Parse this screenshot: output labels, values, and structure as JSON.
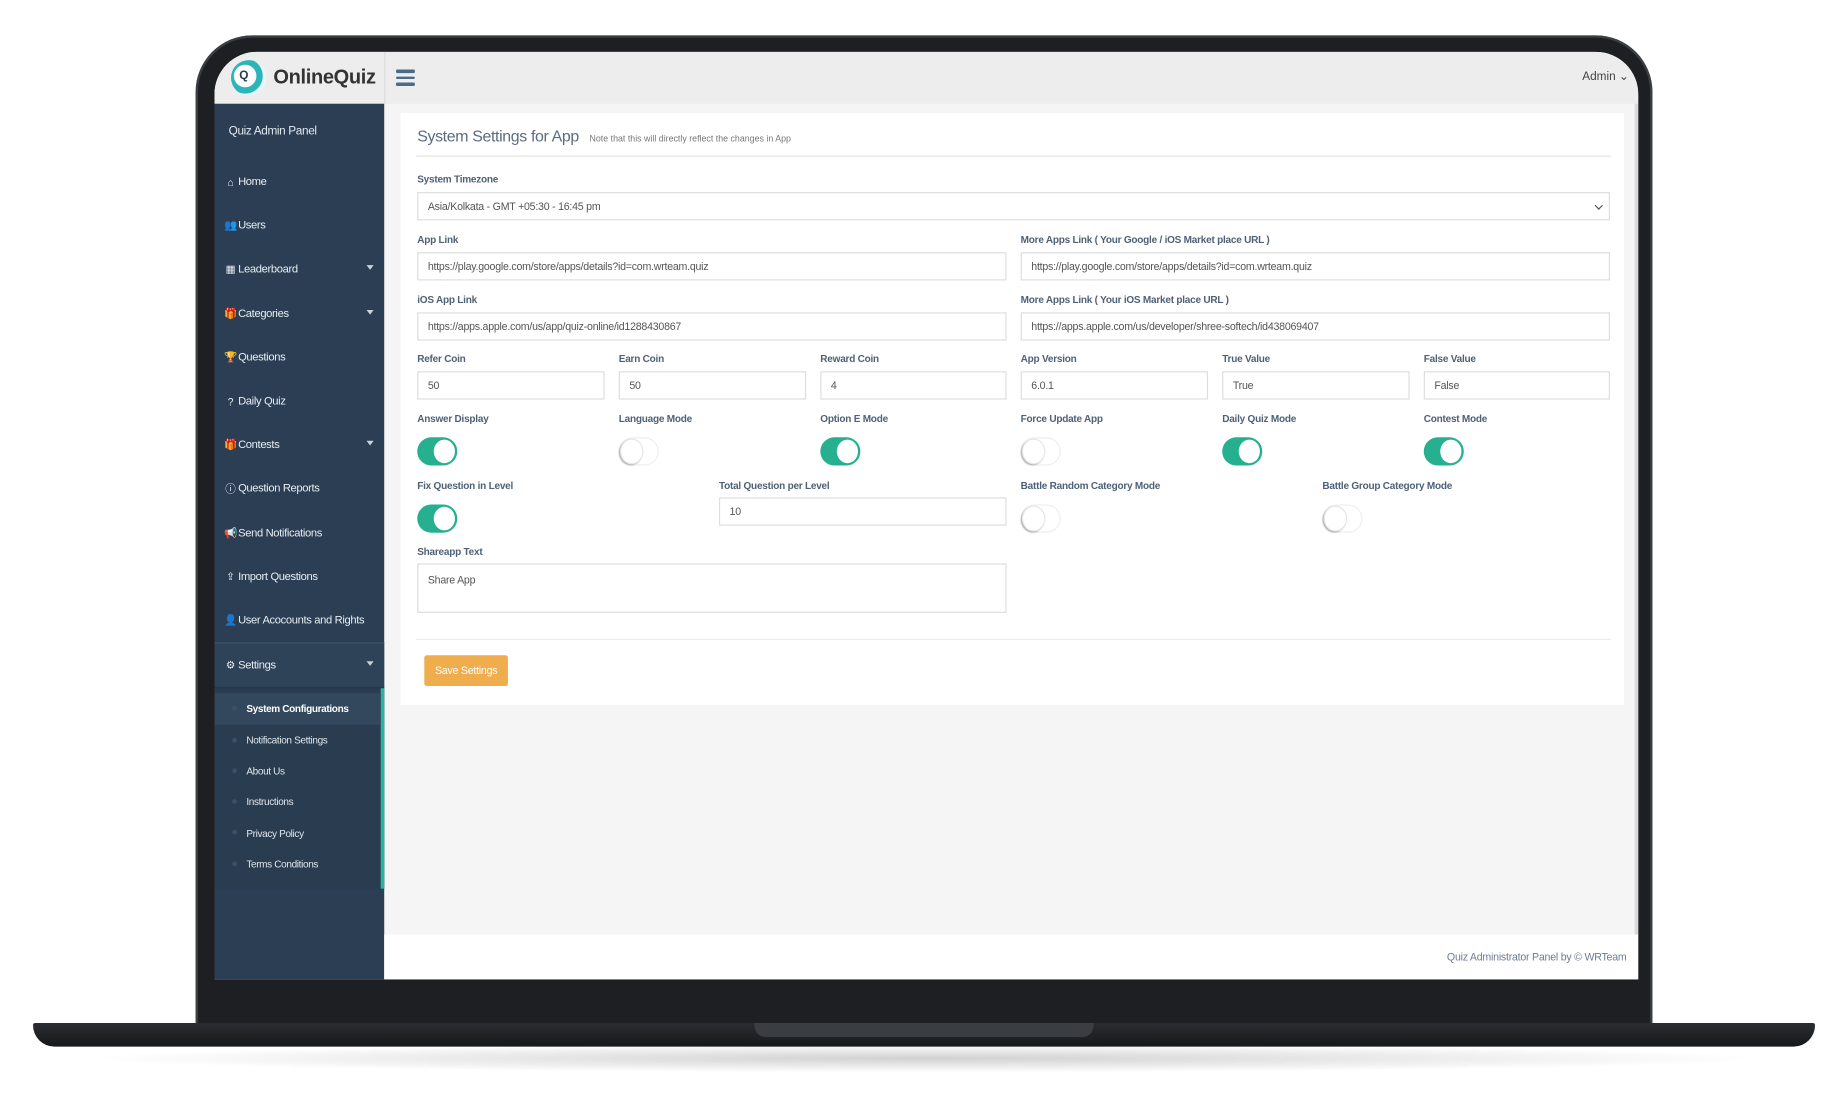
{
  "app": {
    "brand": "OnlineQuiz",
    "logo_text": "Q",
    "user_menu": "Admin"
  },
  "sidebar": {
    "panel_title": "Quiz Admin Panel",
    "items": [
      {
        "label": "Home",
        "icon": "home-icon",
        "glyph": "⌂",
        "has_caret": false
      },
      {
        "label": "Users",
        "icon": "users-icon",
        "glyph": "👥",
        "has_caret": false
      },
      {
        "label": "Leaderboard",
        "icon": "table-icon",
        "glyph": "▦",
        "has_caret": true
      },
      {
        "label": "Categories",
        "icon": "gift-icon",
        "glyph": "🎁",
        "has_caret": true
      },
      {
        "label": "Questions",
        "icon": "trophy-icon",
        "glyph": "🏆",
        "has_caret": false
      },
      {
        "label": "Daily Quiz",
        "icon": "question-icon",
        "glyph": "?",
        "has_caret": false
      },
      {
        "label": "Contests",
        "icon": "gift-icon",
        "glyph": "🎁",
        "has_caret": true
      },
      {
        "label": "Question Reports",
        "icon": "question-circle-icon",
        "glyph": "ⓘ",
        "has_caret": false
      },
      {
        "label": "Send Notifications",
        "icon": "bullhorn-icon",
        "glyph": "📢",
        "has_caret": false
      },
      {
        "label": "Import Questions",
        "icon": "upload-icon",
        "glyph": "⇪",
        "has_caret": false
      },
      {
        "label": "User Acocounts and Rights",
        "icon": "user-icon",
        "glyph": "👤",
        "has_caret": false
      },
      {
        "label": "Settings",
        "icon": "gear-icon",
        "glyph": "⚙",
        "has_caret": true
      }
    ],
    "settings_submenu": [
      {
        "label": "System Configurations",
        "active": true
      },
      {
        "label": "Notification Settings",
        "active": false
      },
      {
        "label": "About Us",
        "active": false
      },
      {
        "label": "Instructions",
        "active": false
      },
      {
        "label": "Privacy Policy",
        "active": false
      },
      {
        "label": "Terms Conditions",
        "active": false
      }
    ]
  },
  "form": {
    "title": "System Settings for App",
    "note": "Note that this will directly reflect the changes in App",
    "timezone": {
      "label": "System Timezone",
      "value": "Asia/Kolkata - GMT +05:30 - 16:45 pm"
    },
    "app_link": {
      "label": "App Link",
      "value": "https://play.google.com/store/apps/details?id=com.wrteam.quiz"
    },
    "more_apps_link": {
      "label": "More Apps Link ( Your Google / iOS Market place URL )",
      "value": "https://play.google.com/store/apps/details?id=com.wrteam.quiz"
    },
    "ios_app_link": {
      "label": "iOS App Link",
      "value": "https://apps.apple.com/us/app/quiz-online/id1288430867"
    },
    "more_apps_ios": {
      "label": "More Apps Link ( Your iOS Market place URL )",
      "value": "https://apps.apple.com/us/developer/shree-softech/id438069407"
    },
    "refer_coin": {
      "label": "Refer Coin",
      "value": "50"
    },
    "earn_coin": {
      "label": "Earn Coin",
      "value": "50"
    },
    "reward_coin": {
      "label": "Reward Coin",
      "value": "4"
    },
    "app_version": {
      "label": "App Version",
      "value": "6.0.1"
    },
    "true_value": {
      "label": "True Value",
      "value": "True"
    },
    "false_value": {
      "label": "False Value",
      "value": "False"
    },
    "toggles": {
      "answer_display": {
        "label": "Answer Display",
        "on": true
      },
      "language_mode": {
        "label": "Language Mode",
        "on": false
      },
      "option_e_mode": {
        "label": "Option E Mode",
        "on": true
      },
      "force_update_app": {
        "label": "Force Update App",
        "on": false
      },
      "daily_quiz_mode": {
        "label": "Daily Quiz Mode",
        "on": true
      },
      "contest_mode": {
        "label": "Contest Mode",
        "on": true
      },
      "fix_question_in_level": {
        "label": "Fix Question in Level",
        "on": true
      },
      "battle_random_category_mode": {
        "label": "Battle Random Category Mode",
        "on": false
      },
      "battle_group_category_mode": {
        "label": "Battle Group Category Mode",
        "on": false
      }
    },
    "total_question_per_level": {
      "label": "Total Question per Level",
      "value": "10"
    },
    "shareapp_text": {
      "label": "Shareapp Text",
      "value": "Share App"
    },
    "save_label": "Save Settings"
  },
  "colors": {
    "sidebar": "#2b3e53",
    "toggle_on": "#26b08f",
    "save_button": "#f0ad4e",
    "submenu_accent": "#2bb5a0"
  },
  "footer": {
    "text": "Quiz Administrator Panel by © WRTeam"
  }
}
